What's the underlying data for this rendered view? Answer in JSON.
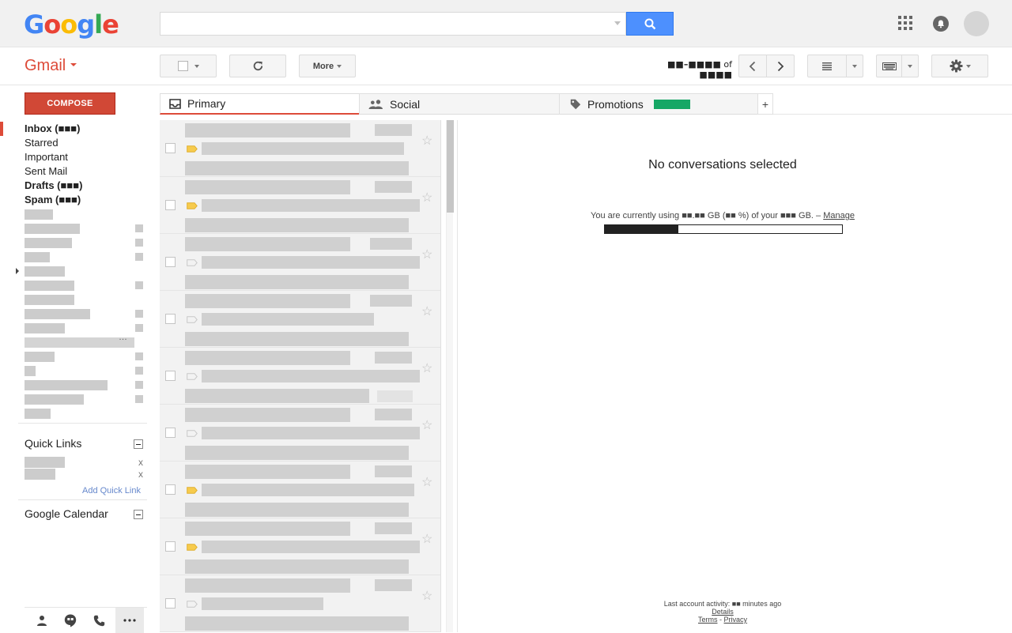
{
  "header": {
    "logo_letters": [
      {
        "ch": "G",
        "color": "#4285F4"
      },
      {
        "ch": "o",
        "color": "#EA4335"
      },
      {
        "ch": "o",
        "color": "#FBBC05"
      },
      {
        "ch": "g",
        "color": "#4285F4"
      },
      {
        "ch": "l",
        "color": "#34A853"
      },
      {
        "ch": "e",
        "color": "#EA4335"
      }
    ],
    "search_value": "",
    "search_placeholder": "",
    "icons": [
      "search-icon",
      "apps-grid-icon",
      "notifications-bell-icon",
      "account-avatar"
    ]
  },
  "toolbar": {
    "app_label": "Gmail",
    "more_label": "More",
    "paging_range": "■■–■■■■",
    "paging_of": "of",
    "paging_total": "■■■■",
    "icons": [
      "refresh-icon",
      "chevron-left-icon",
      "chevron-right-icon",
      "density-icon",
      "keyboard-icon",
      "gear-icon"
    ]
  },
  "sidebar": {
    "compose_label": "COMPOSE",
    "items": [
      {
        "label": "Inbox (■■■)",
        "bold": true,
        "active": true
      },
      {
        "label": "Starred",
        "bold": false
      },
      {
        "label": "Important",
        "bold": false
      },
      {
        "label": "Sent Mail",
        "bold": false
      },
      {
        "label": "Drafts (■■■)",
        "bold": true
      },
      {
        "label": "Spam (■■■)",
        "bold": true
      }
    ],
    "quick_links_title": "Quick Links",
    "add_quick_link": "Add Quick Link",
    "quick_link_remove": "x",
    "calendar_title": "Google Calendar",
    "bottom_icons": [
      "contacts-icon",
      "hangouts-icon",
      "phone-icon",
      "more-dots-icon"
    ]
  },
  "tabs": [
    {
      "label": "Primary",
      "icon": "inbox-icon",
      "active": true
    },
    {
      "label": "Social",
      "icon": "people-icon",
      "active": false
    },
    {
      "label": "Promotions",
      "icon": "tag-icon",
      "active": false,
      "badge_color": "#16a765"
    }
  ],
  "add_tab_label": "+",
  "message_rows": [
    {
      "important": true
    },
    {
      "important": true
    },
    {
      "important": false
    },
    {
      "important": false
    },
    {
      "important": false
    },
    {
      "important": false
    },
    {
      "important": true
    },
    {
      "important": true
    },
    {
      "important": false
    }
  ],
  "reading_pane": {
    "no_selection": "No conversations selected",
    "usage_text": "You are currently using ■■.■■ GB (■■ %) of your ■■■ GB. –",
    "manage_link": "Manage",
    "last_activity": "Last account activity: ■■ minutes ago",
    "details_link": "Details",
    "terms_link": "Terms",
    "footer_sep": "-",
    "privacy_link": "Privacy"
  },
  "colors": {
    "accent_red": "#dd4b39",
    "search_blue": "#4d90fe",
    "important_yellow": "#f7cb4d"
  }
}
